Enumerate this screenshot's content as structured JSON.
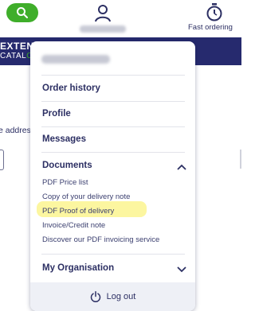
{
  "header": {
    "search_icon": "search-icon",
    "account_icon": "user-icon",
    "fast_ordering_icon": "stopwatch-icon",
    "fast_ordering_label": "Fast ordering"
  },
  "brand": {
    "line1": "EXTEN",
    "line2": "CATAL",
    "line2_dot": "O"
  },
  "background": {
    "address_fragment": "e addres"
  },
  "dropdown": {
    "menu": [
      {
        "label": "Order history"
      },
      {
        "label": "Profile"
      },
      {
        "label": "Messages"
      }
    ],
    "documents": {
      "label": "Documents",
      "expanded": true,
      "items": [
        {
          "label": "PDF Price list"
        },
        {
          "label": "Copy of your delivery note"
        },
        {
          "label": "PDF Proof of delivery",
          "highlighted": true
        },
        {
          "label": "Invoice/Credit note"
        },
        {
          "label": "Discover our PDF invoicing service"
        }
      ]
    },
    "organisation": {
      "label": "My Organisation",
      "expanded": false
    },
    "logout": {
      "label": "Log out",
      "icon": "power-icon"
    }
  },
  "colors": {
    "navy": "#262a6e",
    "green": "#3fae2a",
    "highlight": "#fbf48f",
    "text": "#2c2f63"
  }
}
